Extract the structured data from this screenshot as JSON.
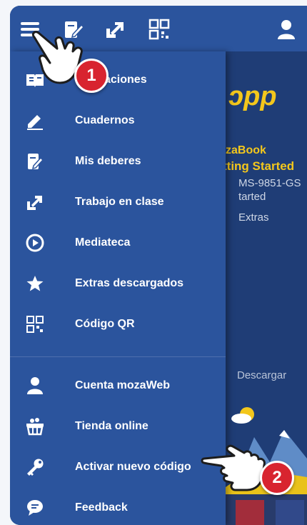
{
  "menu": {
    "items": [
      {
        "label": "aciones",
        "icon": "book-icon"
      },
      {
        "label": "Cuadernos",
        "icon": "pencil-icon"
      },
      {
        "label": "Mis deberes",
        "icon": "homework-icon"
      },
      {
        "label": "Trabajo en clase",
        "icon": "classwork-icon"
      },
      {
        "label": "Mediateca",
        "icon": "media-icon"
      },
      {
        "label": "Extras descargados",
        "icon": "star-icon"
      },
      {
        "label": "Código QR",
        "icon": "qr-icon"
      },
      {
        "label": "Cuenta mozaWeb",
        "icon": "user-icon"
      },
      {
        "label": "Tienda online",
        "icon": "basket-icon"
      },
      {
        "label": "Activar nuevo código",
        "icon": "key-icon"
      },
      {
        "label": "Feedback",
        "icon": "feedback-icon"
      }
    ]
  },
  "app": {
    "logo": "ɔpp",
    "book_title": "zaBook",
    "book_subtitle": "tting Started",
    "code": "MS-9851-GS",
    "started": "tarted",
    "extras": "Extras",
    "download": "Descargar"
  },
  "badges": {
    "first": "1",
    "second": "2"
  },
  "colors": {
    "drawer": "#2b549d",
    "accent": "#f3c71c",
    "badge": "#d8242f"
  }
}
